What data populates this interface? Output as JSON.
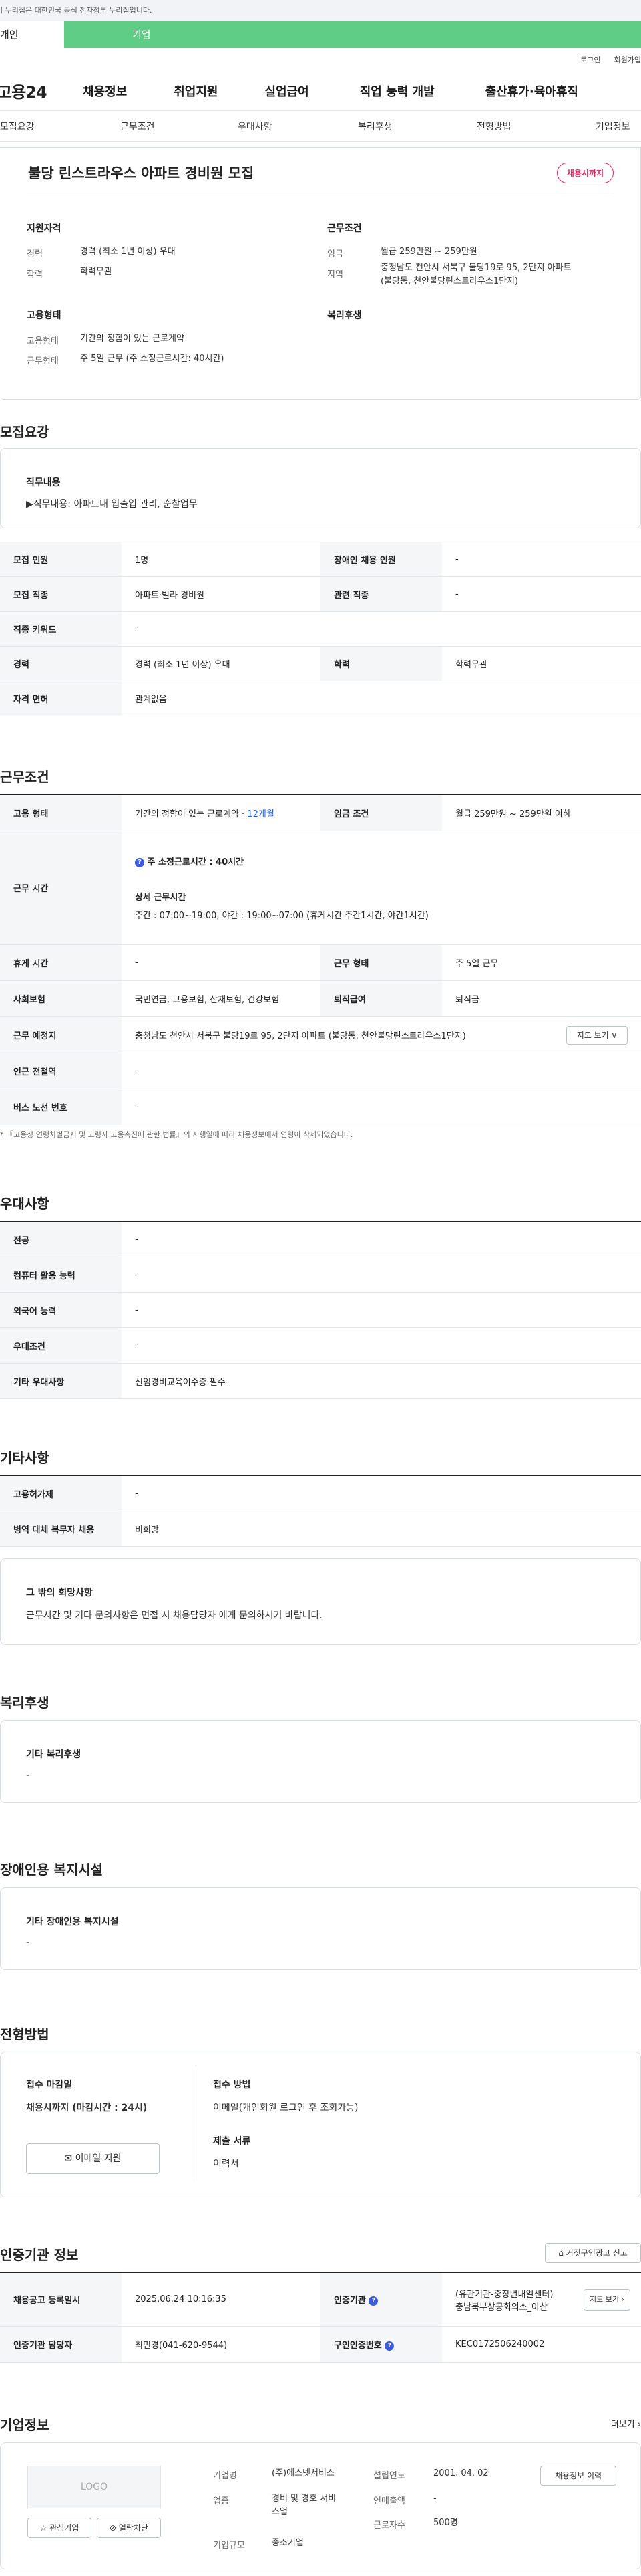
{
  "gov_bar": {
    "text": "이 누리집은 대한민국 공식 전자정부 누리집입니다."
  },
  "user_tabs": {
    "personal": "개인",
    "corporate": "기업"
  },
  "util": {
    "login": "로그인",
    "join": "회원가입"
  },
  "gnb": {
    "logo": "고용24",
    "items": [
      "채용정보",
      "취업지원",
      "실업급여",
      "직업 능력 개발",
      "출산휴가·육아휴직"
    ]
  },
  "anchors": [
    "모집요강",
    "근무조건",
    "우대사항",
    "복리후생",
    "전형방법",
    "기업정보"
  ],
  "summary": {
    "title": "불당 린스트라우스 아파트 경비원 모집",
    "badge": "채용시까지",
    "qualification_heading": "지원자격",
    "career_k": "경력",
    "career_v": "경력 (최소 1년 이상) 우대",
    "edu_k": "학력",
    "edu_v": "학력무관",
    "employ_heading": "고용형태",
    "employ_k": "고용형태",
    "employ_v": "기간의 정함이 있는 근로계약",
    "worktype_k": "근무형태",
    "worktype_v": "주 5일 근무 (주 소정근로시간: 40시간)",
    "condition_heading": "근무조건",
    "wage_k": "임금",
    "wage_v": "월급 259만원 ~ 259만원",
    "region_k": "지역",
    "region_v1": "충청남도 천안시 서북구 불당19로 95, 2단지 아파트",
    "region_v2": "(불당동, 천안불당린스트라우스1단지)",
    "welfare_heading": "복리후생"
  },
  "recruit": {
    "heading": "모집요강",
    "duty_title": "직무내용",
    "duty_text": "▶직무내용: 아파트내 입출입 관리, 순찰업무",
    "rows": {
      "count_k": "모집 인원",
      "count_v": "1명",
      "disabled_k": "장애인 채용 인원",
      "disabled_v": "-",
      "job_k": "모집 직종",
      "job_v": "아파트·빌라 경비원",
      "related_k": "관련 직종",
      "related_v": "-",
      "keyword_k": "직종 키워드",
      "keyword_v": "-",
      "career_k": "경력",
      "career_v": "경력 (최소 1년 이상) 우대",
      "edu_k": "학력",
      "edu_v": "학력무관",
      "license_k": "자격 면허",
      "license_v": "관계없음"
    }
  },
  "conditions": {
    "heading": "근무조건",
    "employ_k": "고용 형태",
    "employ_v": "기간의 정함이 있는 근로계약 · ",
    "employ_months": "12개월",
    "wage_k": "임금 조건",
    "wage_v": "월급 259만원 ~ 259만원 이하",
    "hours_k": "근무 시간",
    "hours_week": "주 소정근로시간 : 40시간",
    "hours_detail_t": "상세 근무시간",
    "hours_detail_v": "주간 : 07:00~19:00, 야간 : 19:00~07:00 (휴게시간 주간1시간, 야간1시간)",
    "rest_k": "휴게 시간",
    "rest_v": "-",
    "form_k": "근무 형태",
    "form_v": "주 5일 근무",
    "ins_k": "사회보험",
    "ins_v": "국민연금, 고용보험, 산재보험, 건강보험",
    "sev_k": "퇴직급여",
    "sev_v": "퇴직금",
    "place_k": "근무 예정지",
    "place_v": "충청남도 천안시 서북구 불당19로 95, 2단지 아파트 (불당동, 천안불당린스트라우스1단지)",
    "map_btn": "지도 보기 ∨",
    "subway_k": "인근 전철역",
    "subway_v": "-",
    "bus_k": "버스 노선 번호",
    "bus_v": "-",
    "note": "* 『고용상 연령차별금지 및 고령자 고용촉진에 관한 법률』의 시행일에 따라 채용정보에서 연령이 삭제되었습니다."
  },
  "preference": {
    "heading": "우대사항",
    "major_k": "전공",
    "major_v": "-",
    "pc_k": "컴퓨터 활용 능력",
    "pc_v": "-",
    "lang_k": "외국어 능력",
    "lang_v": "-",
    "pref_k": "우대조건",
    "pref_v": "-",
    "etc_k": "기타 우대사항",
    "etc_v": "신임경비교육이수증 필수"
  },
  "etc": {
    "heading": "기타사항",
    "permit_k": "고용허가제",
    "permit_v": "-",
    "mil_k": "병역 대체 복무자 채용",
    "mil_v": "비희망",
    "box_t": "그 밖의 희망사항",
    "box_v": "근무시간 및 기타 문의사항은 면접 시 채용담당자 에게 문의하시기 바랍니다."
  },
  "welfare": {
    "heading": "복리후생",
    "box_t": "기타 복리후생",
    "box_v": "-"
  },
  "disabled_facility": {
    "heading": "장애인용 복지시설",
    "box_t": "기타 장애인용 복지시설",
    "box_v": "-"
  },
  "selection": {
    "heading": "전형방법",
    "deadline_t": "접수 마감일",
    "deadline_v": "채용시까지 (마감시간 : 24시)",
    "method_t": "접수 방법",
    "method_v": "이메일(개인회원 로그인 후 조회가능)",
    "docs_t": "제출 서류",
    "docs_v": "이력서",
    "email_btn": "이메일 지원"
  },
  "agency": {
    "heading": "인증기관 정보",
    "report_btn": "거짓구인광고 신고",
    "reg_k": "채용공고 등록일시",
    "reg_v": "2025.06.24 10:16:35",
    "agency_k": "인증기관",
    "agency_v1": "(유관기관-중장년내일센터)",
    "agency_v2": "충남북부상공회의소_아산",
    "map_btn": "지도 보기",
    "staff_k": "인증기관 담당자",
    "staff_v": "최민경(041-620-9544)",
    "num_k": "구인인증번호",
    "num_v": "KEC0172506240002"
  },
  "company": {
    "heading": "기업정보",
    "more": "더보기",
    "logo_text": "LOGO",
    "fav_btn": "관심기업",
    "block_btn": "열람차단",
    "name_k": "기업명",
    "name_v": "(주)에스넷서비스",
    "founded_k": "설립연도",
    "founded_v": "2001. 04. 02",
    "industry_k": "업종",
    "industry_v1": "경비 및 경호 서비",
    "industry_v2": "스업",
    "sales_k": "연매출액",
    "sales_v": "-",
    "scale_k": "기업규모",
    "scale_v": "중소기업",
    "emp_k": "근로자수",
    "emp_v": "500명",
    "jobs_btn": "채용정보 이력"
  }
}
